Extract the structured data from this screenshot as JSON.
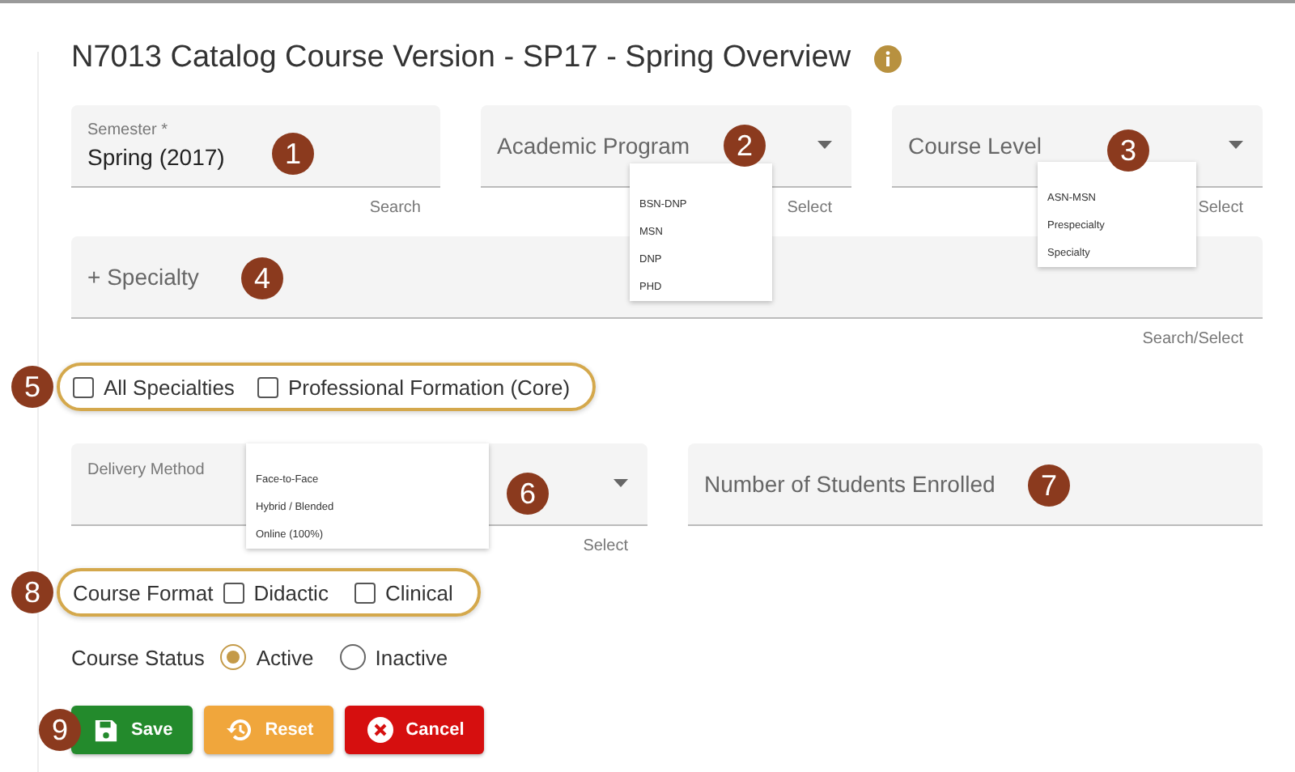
{
  "title": "N7013 Catalog Course Version - SP17 - Spring Overview",
  "row1": [
    {
      "label": "Semester *",
      "value": "Spring (2017)",
      "helper": "Search",
      "callout": "1",
      "kind": "text"
    },
    {
      "label": "Academic Program",
      "helper": "Select",
      "callout": "2",
      "kind": "select",
      "options": [
        "BSN-DNP",
        "MSN",
        "DNP",
        "PHD"
      ]
    },
    {
      "label": "Course Level",
      "helper": "Select",
      "callout": "3",
      "kind": "select",
      "options": [
        "ASN-MSN",
        "Prespecialty",
        "Specialty"
      ]
    }
  ],
  "specialty": {
    "placeholder": "+ Specialty",
    "helper": "Search/Select",
    "callout": "4"
  },
  "specialty_checks": {
    "callout": "5",
    "items": [
      {
        "label": "All Specialties",
        "checked": false
      },
      {
        "label": "Professional Formation (Core)",
        "checked": false
      }
    ]
  },
  "delivery": {
    "label": "Delivery Method",
    "helper": "Select",
    "callout": "6",
    "options": [
      "Face-to-Face",
      "Hybrid / Blended",
      "Online (100%)"
    ]
  },
  "enrolled": {
    "placeholder": "Number of Students Enrolled",
    "callout": "7"
  },
  "course_format": {
    "label": "Course Format",
    "callout": "8",
    "items": [
      {
        "label": "Didactic",
        "checked": false
      },
      {
        "label": "Clinical",
        "checked": false
      }
    ]
  },
  "course_status": {
    "label": "Course Status",
    "items": [
      {
        "label": "Active",
        "selected": true
      },
      {
        "label": "Inactive",
        "selected": false
      }
    ]
  },
  "buttons": [
    {
      "kind": "save",
      "label": "Save"
    },
    {
      "kind": "reset",
      "label": "Reset"
    },
    {
      "kind": "cancel",
      "label": "Cancel"
    }
  ],
  "buttons_callout": "9"
}
